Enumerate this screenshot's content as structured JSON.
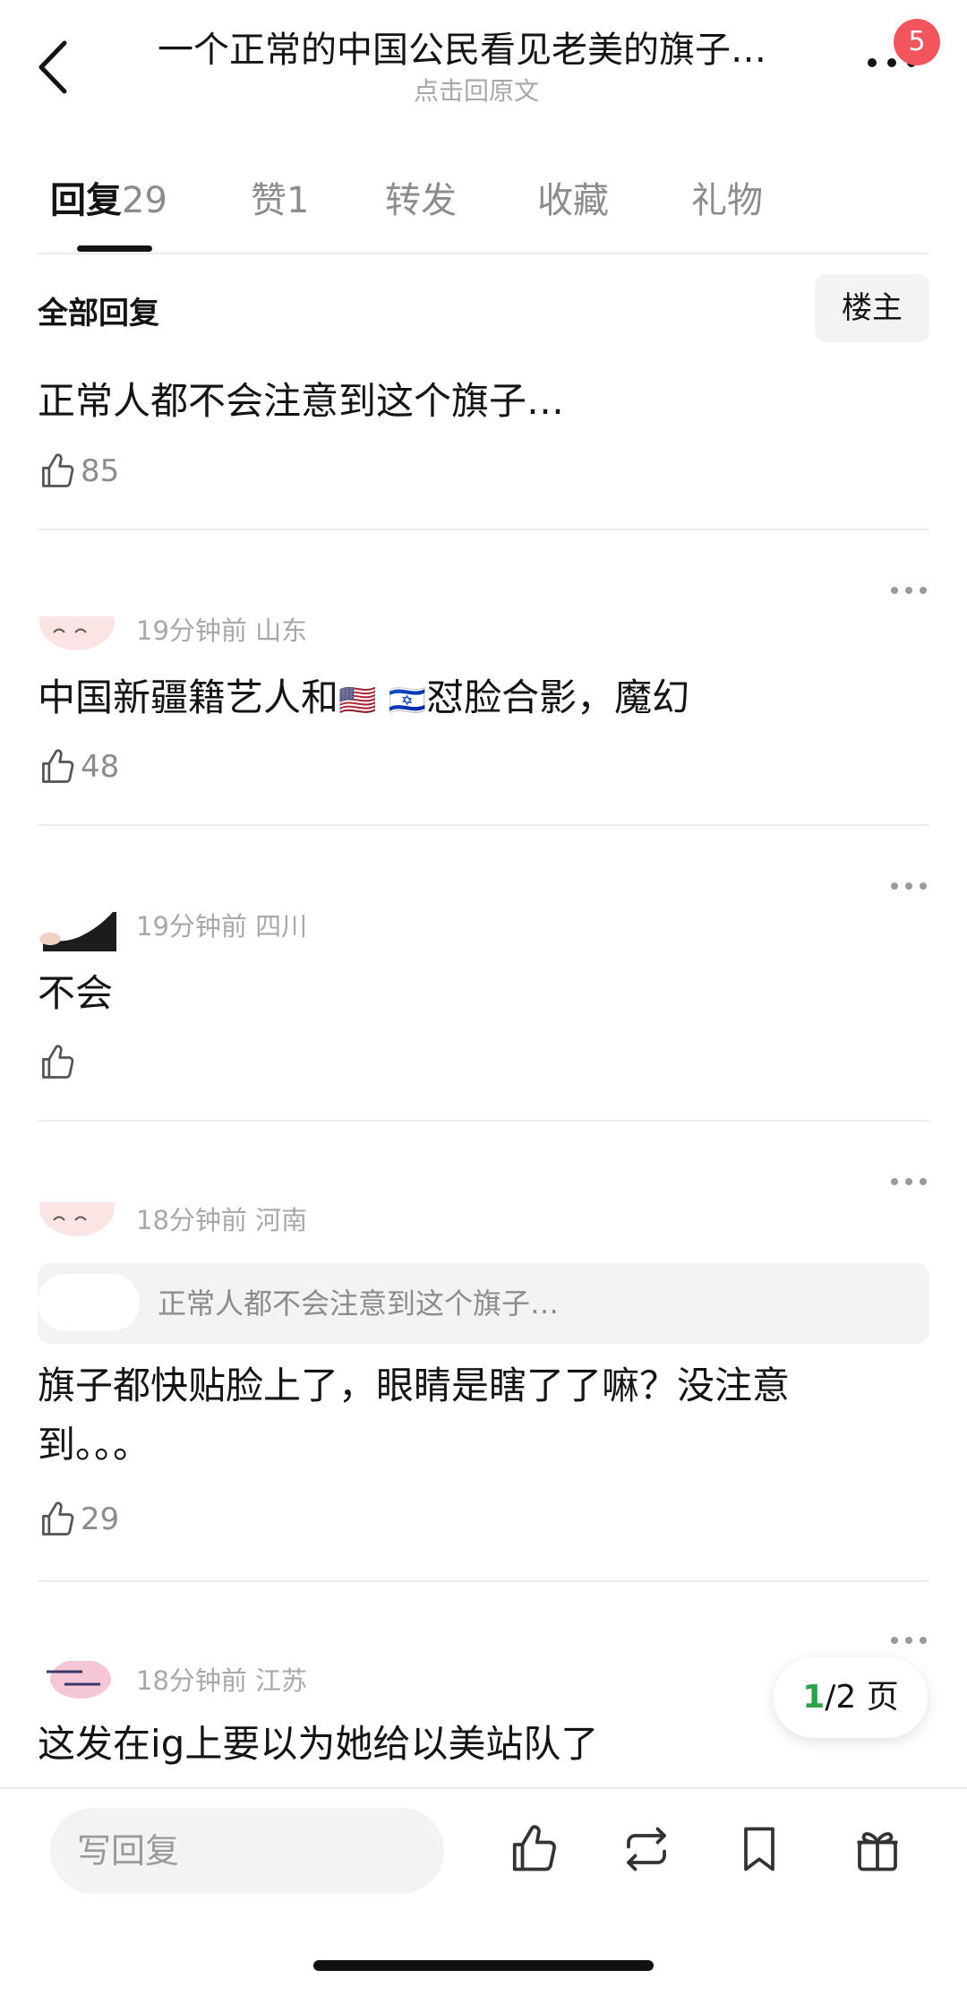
{
  "header": {
    "back_icon": "chevron-left-icon",
    "title": "一个正常的中国公民看见老美的旗子…",
    "subtitle": "点击回原文",
    "more_icon": "more-horizontal-icon",
    "badge_count": "5",
    "badge_color": "#f2555b"
  },
  "tabs": [
    {
      "label": "回复",
      "count": "29",
      "active": true
    },
    {
      "label": "赞",
      "count": "1"
    },
    {
      "label": "转发"
    },
    {
      "label": "收藏"
    },
    {
      "label": "礼物"
    }
  ],
  "section": {
    "title": "全部回复",
    "owner_button": "楼主"
  },
  "post": {
    "text": "正常人都不会注意到这个旗子…",
    "likes": "85"
  },
  "comments": [
    {
      "time": "19分钟前",
      "region": "山东",
      "text_before_flags": "中国新疆籍艺人和",
      "flags": [
        "🇺🇸",
        "🇮🇱"
      ],
      "text_after_flags": "怼脸合影，魔幻",
      "likes": "48"
    },
    {
      "time": "19分钟前",
      "region": "四川",
      "text": "不会",
      "likes": ""
    },
    {
      "time": "18分钟前",
      "region": "河南",
      "quote": "正常人都不会注意到这个旗子…",
      "text_line1": "旗子都快贴脸上了，眼睛是瞎了了嘛？没注意",
      "text_line2": "到。。。",
      "likes": "29"
    },
    {
      "time": "18分钟前",
      "region": "江苏",
      "text": "这发在ig上要以为她给以美站队了"
    }
  ],
  "pager": {
    "current": "1",
    "total": "/2",
    "unit": "页"
  },
  "bottom_bar": {
    "reply_placeholder": "写回复",
    "icons": [
      "thumbs-up-icon",
      "repost-icon",
      "bookmark-icon",
      "gift-icon"
    ]
  },
  "colors": {
    "accent_green": "#2aa34a",
    "text_gray": "#8c8c8c"
  }
}
